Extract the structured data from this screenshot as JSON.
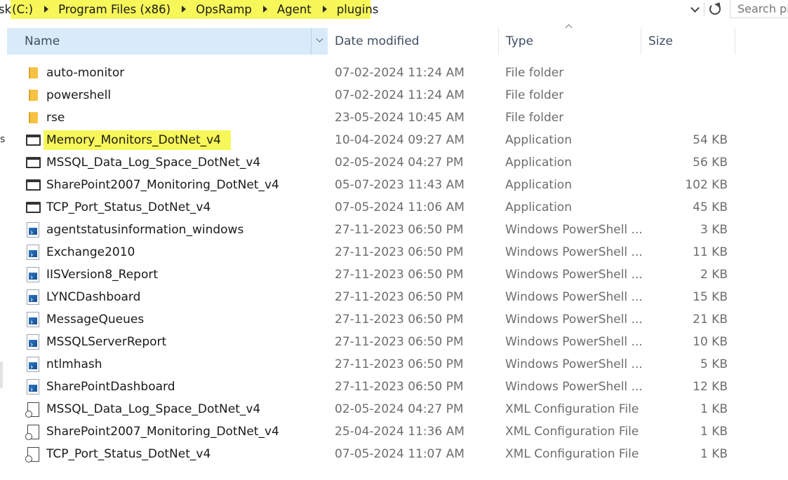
{
  "address": {
    "prefix": "sk",
    "crumbs": [
      "(C:)",
      "Program Files (x86)",
      "OpsRamp",
      "Agent",
      "plugins"
    ],
    "search_placeholder": "Search pl"
  },
  "left_edge_mark": "s",
  "columns": {
    "name": "Name",
    "date": "Date modified",
    "type": "Type",
    "size": "Size"
  },
  "files": [
    {
      "icon": "folder-icon",
      "name": "auto-monitor",
      "date": "07-02-2024 11:24 AM",
      "type": "File folder",
      "size": ""
    },
    {
      "icon": "folder-icon",
      "name": "powershell",
      "date": "07-02-2024 11:24 AM",
      "type": "File folder",
      "size": ""
    },
    {
      "icon": "folder-icon",
      "name": "rse",
      "date": "23-05-2024 10:45 AM",
      "type": "File folder",
      "size": ""
    },
    {
      "icon": "application-icon",
      "name": "Memory_Monitors_DotNet_v4",
      "date": "10-04-2024 09:27 AM",
      "type": "Application",
      "size": "54 KB",
      "highlighted": true
    },
    {
      "icon": "application-icon",
      "name": "MSSQL_Data_Log_Space_DotNet_v4",
      "date": "02-05-2024 04:27 PM",
      "type": "Application",
      "size": "56 KB"
    },
    {
      "icon": "application-icon",
      "name": "SharePoint2007_Monitoring_DotNet_v4",
      "date": "05-07-2023 11:43 AM",
      "type": "Application",
      "size": "102 KB"
    },
    {
      "icon": "application-icon",
      "name": "TCP_Port_Status_DotNet_v4",
      "date": "07-05-2024 11:06 AM",
      "type": "Application",
      "size": "45 KB"
    },
    {
      "icon": "powershell-script-icon",
      "name": "agentstatusinformation_windows",
      "date": "27-11-2023 06:50 PM",
      "type": "Windows PowerShell ...",
      "size": "3 KB"
    },
    {
      "icon": "powershell-script-icon",
      "name": "Exchange2010",
      "date": "27-11-2023 06:50 PM",
      "type": "Windows PowerShell ...",
      "size": "11 KB"
    },
    {
      "icon": "powershell-script-icon",
      "name": "IISVersion8_Report",
      "date": "27-11-2023 06:50 PM",
      "type": "Windows PowerShell ...",
      "size": "2 KB"
    },
    {
      "icon": "powershell-script-icon",
      "name": "LYNCDashboard",
      "date": "27-11-2023 06:50 PM",
      "type": "Windows PowerShell ...",
      "size": "15 KB"
    },
    {
      "icon": "powershell-script-icon",
      "name": "MessageQueues",
      "date": "27-11-2023 06:50 PM",
      "type": "Windows PowerShell ...",
      "size": "21 KB"
    },
    {
      "icon": "powershell-script-icon",
      "name": "MSSQLServerReport",
      "date": "27-11-2023 06:50 PM",
      "type": "Windows PowerShell ...",
      "size": "10 KB"
    },
    {
      "icon": "powershell-script-icon",
      "name": "ntlmhash",
      "date": "27-11-2023 06:50 PM",
      "type": "Windows PowerShell ...",
      "size": "5 KB"
    },
    {
      "icon": "powershell-script-icon",
      "name": "SharePointDashboard",
      "date": "27-11-2023 06:50 PM",
      "type": "Windows PowerShell ...",
      "size": "12 KB"
    },
    {
      "icon": "xml-config-icon",
      "name": "MSSQL_Data_Log_Space_DotNet_v4",
      "date": "02-05-2024 04:27 PM",
      "type": "XML Configuration File",
      "size": "1 KB"
    },
    {
      "icon": "xml-config-icon",
      "name": "SharePoint2007_Monitoring_DotNet_v4",
      "date": "25-04-2024 11:36 AM",
      "type": "XML Configuration File",
      "size": "1 KB"
    },
    {
      "icon": "xml-config-icon",
      "name": "TCP_Port_Status_DotNet_v4",
      "date": "07-05-2024 11:07 AM",
      "type": "XML Configuration File",
      "size": "1 KB"
    }
  ],
  "colors": {
    "highlight": "#f7f75a",
    "header_selected": "#d9ebf9",
    "folder": "#f6c244",
    "secondary_text": "#6d6d6d"
  }
}
